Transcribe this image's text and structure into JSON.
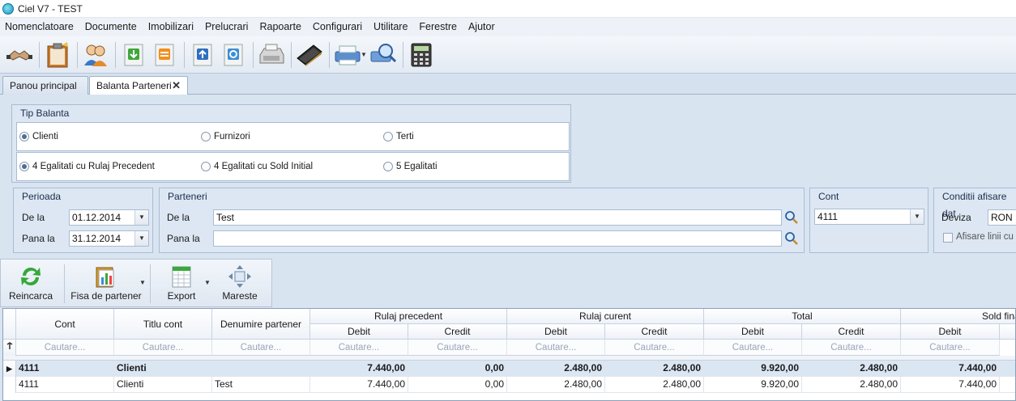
{
  "window": {
    "title": "Ciel V7 - TEST"
  },
  "menu": [
    "Nomenclatoare",
    "Documente",
    "Imobilizari",
    "Prelucrari",
    "Rapoarte",
    "Configurari",
    "Utilitare",
    "Ferestre",
    "Ajutor"
  ],
  "toolbar_icons": [
    "handshake-icon",
    "clipboard-icon",
    "users-icon",
    "import-icon",
    "transfer-icon",
    "upload-icon",
    "refresh-doc-icon",
    "cash-register-icon",
    "book-icon",
    "printer-icon",
    "search-preview-icon",
    "calculator-icon"
  ],
  "tabs": [
    {
      "label": "Panou principal",
      "active": false
    },
    {
      "label": "Balanta Parteneri",
      "active": true,
      "close": "✕"
    }
  ],
  "tip_balanta": {
    "title": "Tip Balanta",
    "row1": [
      {
        "label": "Clienti",
        "checked": true
      },
      {
        "label": "Furnizori",
        "checked": false
      },
      {
        "label": "Terti",
        "checked": false
      }
    ],
    "row2": [
      {
        "label": "4 Egalitati cu Rulaj Precedent",
        "checked": true
      },
      {
        "label": "4 Egalitati cu Sold Initial",
        "checked": false
      },
      {
        "label": "5 Egalitati",
        "checked": false
      }
    ]
  },
  "perioada": {
    "title": "Perioada",
    "from_label": "De la",
    "from_value": "01.12.2014",
    "to_label": "Pana la",
    "to_value": "31.12.2014",
    "dropdown": "▼"
  },
  "parteneri": {
    "title": "Parteneri",
    "from_label": "De la",
    "from_value": "Test",
    "to_label": "Pana la",
    "to_value": ""
  },
  "cont": {
    "title": "Cont",
    "value": "4111",
    "dropdown": "▼"
  },
  "conditii": {
    "title": "Conditii afisare dat",
    "deviza_label": "Deviza",
    "deviza_value": "RON",
    "checkbox_label": "Afisare linii cu v"
  },
  "actions": [
    {
      "label": "Reincarca"
    },
    {
      "label": "Fisa de partener",
      "dropdown": "▼"
    },
    {
      "label": "Export",
      "dropdown": "▼"
    },
    {
      "label": "Mareste"
    }
  ],
  "grid": {
    "headers": {
      "cont": "Cont",
      "titlu": "Titlu cont",
      "denumire": "Denumire partener",
      "rulaj_precedent": "Rulaj precedent",
      "rulaj_curent": "Rulaj curent",
      "total": "Total",
      "sold_final": "Sold fina",
      "debit": "Debit",
      "credit": "Credit"
    },
    "filter_placeholder": "Cautare...",
    "rows": [
      {
        "cont": "4111",
        "titlu": "Clienti",
        "denumire": "",
        "rp_debit": "7.440,00",
        "rp_credit": "0,00",
        "rc_debit": "2.480,00",
        "rc_credit": "2.480,00",
        "t_debit": "9.920,00",
        "t_credit": "2.480,00",
        "sf_debit": "7.440,00",
        "group": true,
        "indicator": "▶"
      },
      {
        "cont": "4111",
        "titlu": "Clienti",
        "denumire": "Test",
        "rp_debit": "7.440,00",
        "rp_credit": "0,00",
        "rc_debit": "2.480,00",
        "rc_credit": "2.480,00",
        "t_debit": "9.920,00",
        "t_credit": "2.480,00",
        "sf_debit": "7.440,00",
        "group": false,
        "indicator": ""
      }
    ]
  }
}
